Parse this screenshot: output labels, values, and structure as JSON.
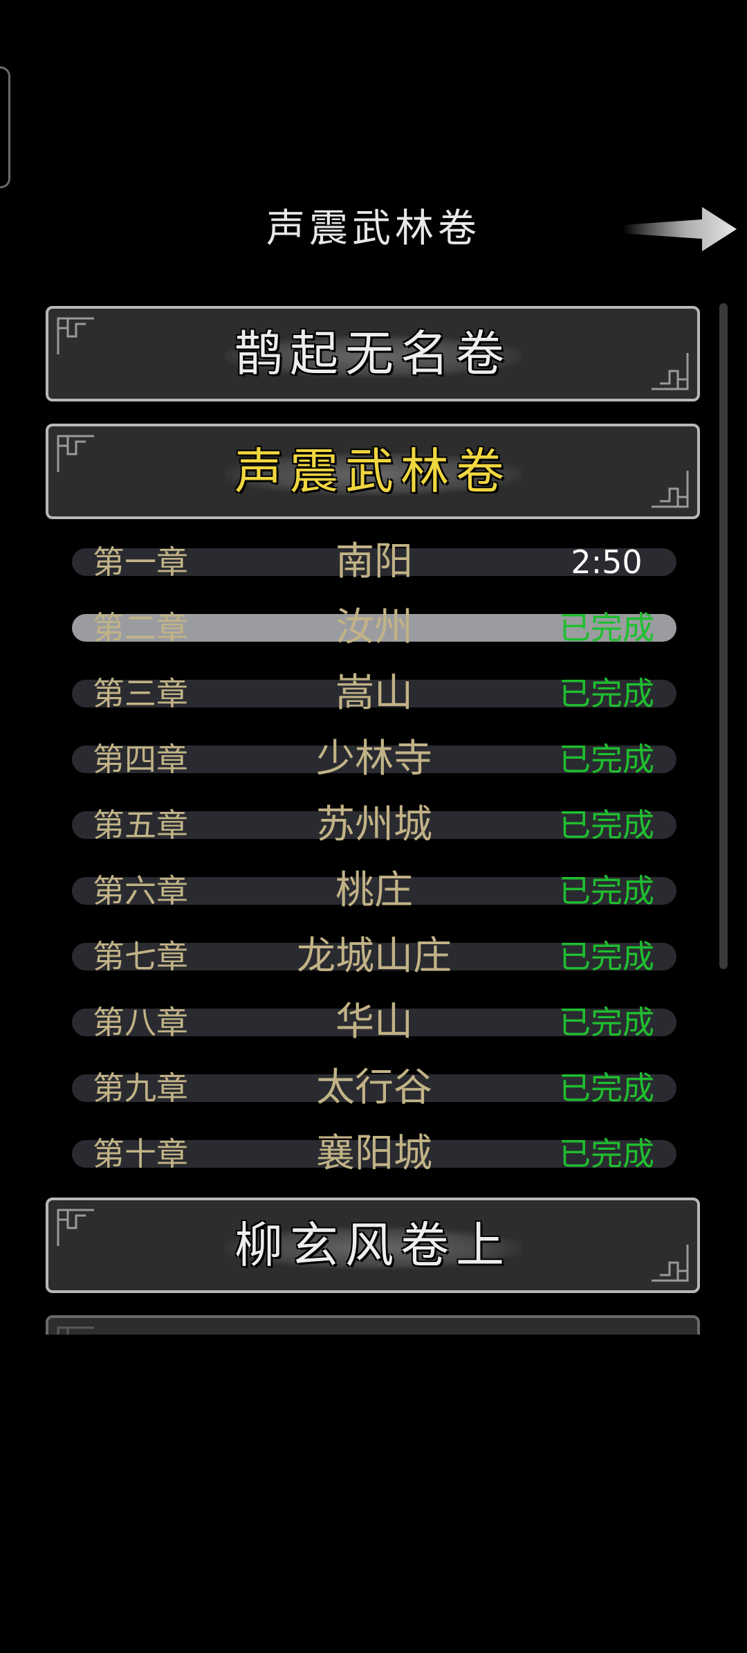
{
  "header": {
    "title": "声震武林卷"
  },
  "volumes": [
    {
      "title": "鹊起无名卷",
      "active": false
    },
    {
      "title": "声震武林卷",
      "active": true
    },
    {
      "title": "柳玄风卷上",
      "active": false
    }
  ],
  "chapters": [
    {
      "number": "第一章",
      "name": "南阳",
      "status": "2:50"
    },
    {
      "number": "第二章",
      "name": "汝州",
      "status": "已完成"
    },
    {
      "number": "第三章",
      "name": "嵩山",
      "status": "已完成"
    },
    {
      "number": "第四章",
      "name": "少林寺",
      "status": "已完成"
    },
    {
      "number": "第五章",
      "name": "苏州城",
      "status": "已完成"
    },
    {
      "number": "第六章",
      "name": "桃庄",
      "status": "已完成"
    },
    {
      "number": "第七章",
      "name": "龙城山庄",
      "status": "已完成"
    },
    {
      "number": "第八章",
      "name": "华山",
      "status": "已完成"
    },
    {
      "number": "第九章",
      "name": "太行谷",
      "status": "已完成"
    },
    {
      "number": "第十章",
      "name": "襄阳城",
      "status": "已完成"
    }
  ],
  "colors": {
    "background": "#000000",
    "chapter_text": "#c2b387",
    "completed": "#1fbf2f",
    "active_volume": "#f0d640",
    "selected_row": "#9a9ca0"
  },
  "icons": {
    "next": "arrow-right-icon",
    "corner": "corner-ornament-icon"
  }
}
